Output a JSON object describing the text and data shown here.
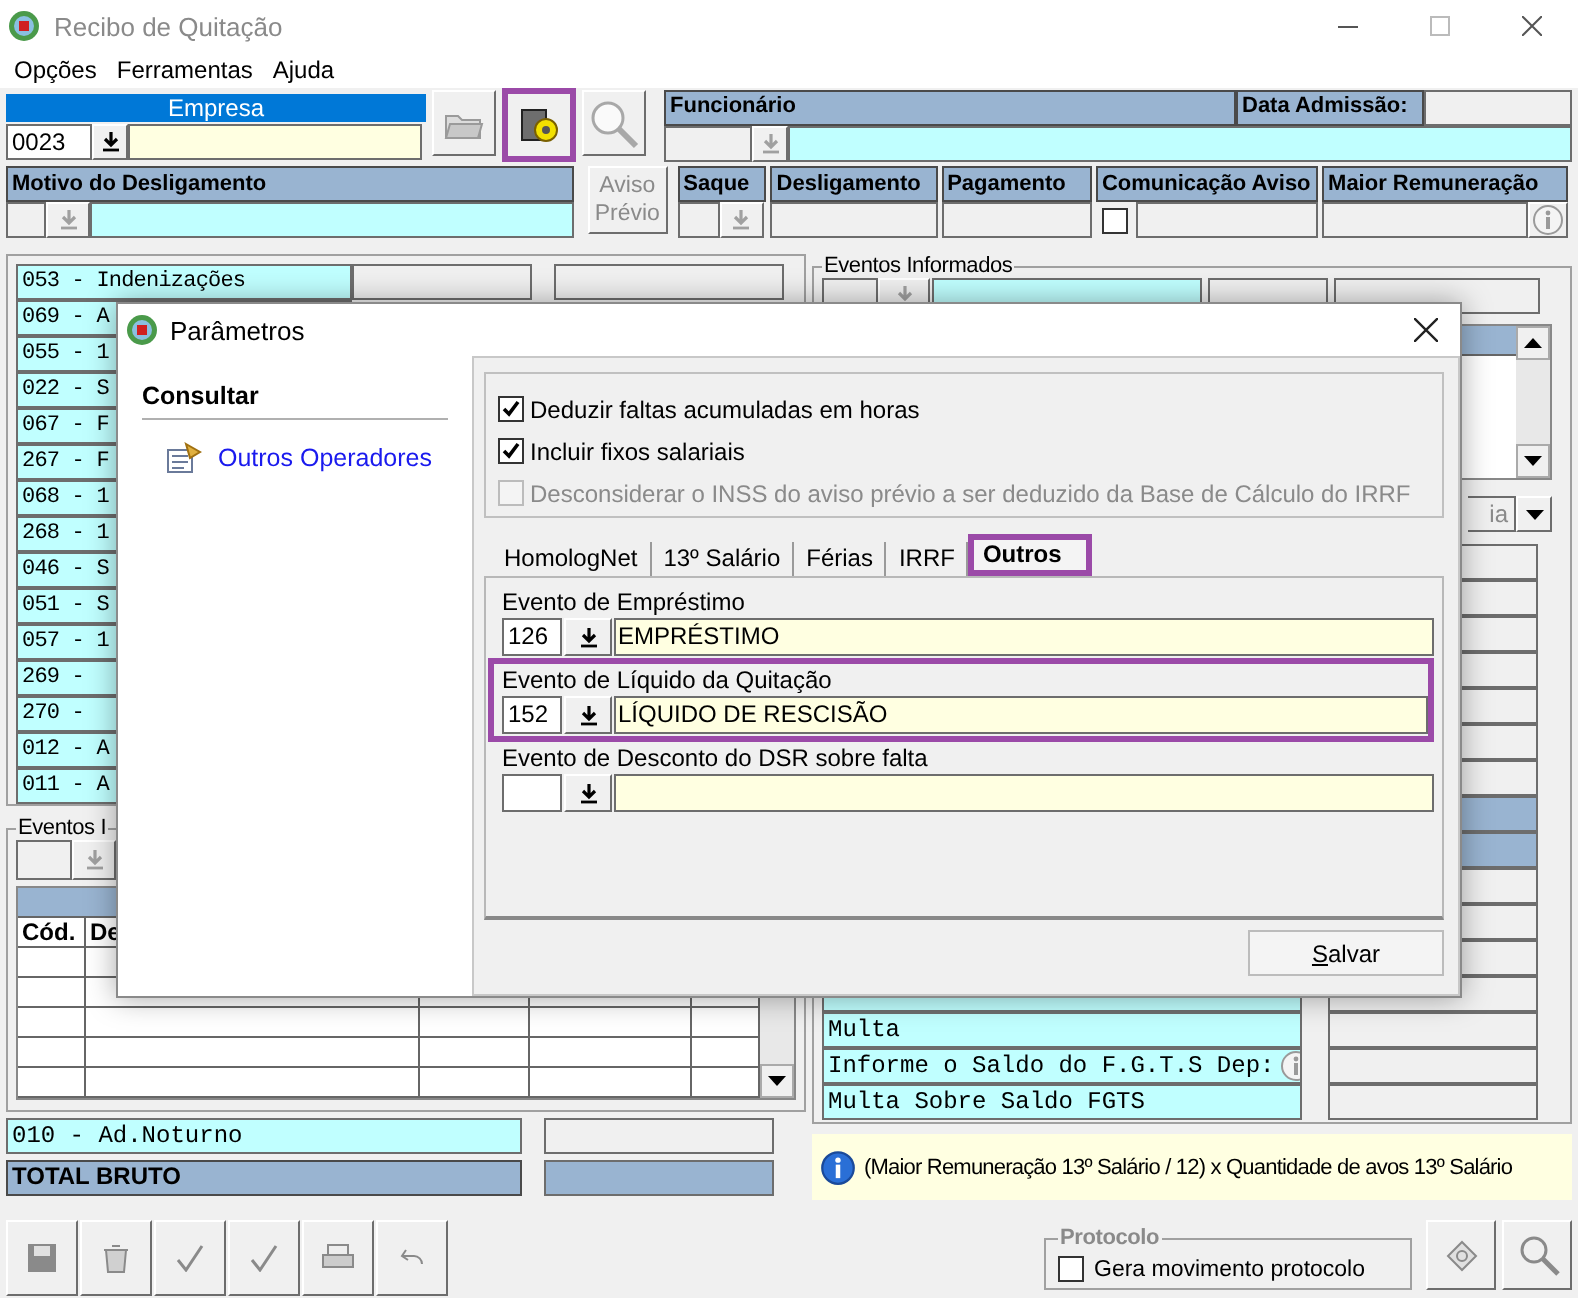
{
  "window": {
    "title": "Recibo de Quitação"
  },
  "menu": [
    "Opções",
    "Ferramentas",
    "Ajuda"
  ],
  "empresa": {
    "label": "Empresa",
    "code": "0023"
  },
  "top_buttons": [
    {
      "kind": "folder",
      "highlighted": false
    },
    {
      "kind": "gear",
      "highlighted": true
    },
    {
      "kind": "magnifier",
      "highlighted": false
    }
  ],
  "funcionario": {
    "label": "Funcionário",
    "admission_label": "Data Admissão:"
  },
  "desligamento": {
    "label": "Motivo do Desligamento",
    "aviso_button": "Aviso Prévio",
    "columns": [
      {
        "label": "Saque",
        "kind": "lookup"
      },
      {
        "label": "Desligamento",
        "kind": "field"
      },
      {
        "label": "Pagamento",
        "kind": "field"
      },
      {
        "label": "Comunicação Aviso",
        "kind": "check",
        "checked": false
      },
      {
        "label": "Maior Remuneração",
        "kind": "info"
      }
    ]
  },
  "event_list": [
    "053 - Indenizações",
    "069 - A",
    "055 - 1",
    "022 - S",
    "067 - F",
    "267 - F",
    "068 - 1",
    "268 - 1",
    "046 - S",
    "051 - S",
    "057 - 1",
    "269 -",
    "270 -",
    "012 - A",
    "011 - A"
  ],
  "eventos": {
    "title": "Eventos I",
    "columns": [
      "Cód.",
      "De"
    ],
    "summary": "010 - Ad.Noturno",
    "total": "TOTAL BRUTO"
  },
  "eventos_informados": {
    "title": "Eventos Informados",
    "combo": "ia",
    "rows": [
      {
        "text": "Multa",
        "info": false
      },
      {
        "text": "Informe o Saldo do F.G.T.S Dep:",
        "info": true
      },
      {
        "text": "Multa Sobre Saldo FGTS",
        "info": false
      }
    ]
  },
  "note": "(Maior Remuneração 13º Salário / 12) x Quantidade de avos 13º Salário",
  "protocolo": {
    "title": "Protocolo",
    "option": "Gera movimento protocolo",
    "checked": false
  },
  "dialog": {
    "title": "Parâmetros",
    "sidebar": {
      "heading": "Consultar",
      "items": [
        "Outros Operadores"
      ]
    },
    "options": [
      {
        "label": "Deduzir faltas acumuladas em horas",
        "checked": true,
        "disabled": false
      },
      {
        "label": "Incluir fixos salariais",
        "checked": true,
        "disabled": false
      },
      {
        "label": "Desconsiderar o INSS do aviso prévio a ser deduzido da Base de Cálculo do IRRF",
        "checked": false,
        "disabled": true
      }
    ],
    "tabs": [
      {
        "label": "HomologNet",
        "selected": false
      },
      {
        "label": "13º Salário",
        "selected": false
      },
      {
        "label": "Férias",
        "selected": false
      },
      {
        "label": "IRRF",
        "selected": false
      },
      {
        "label": "Outros",
        "selected": true
      }
    ],
    "fields": [
      {
        "label": "Evento de Empréstimo",
        "code": "126",
        "description": "EMPRÉSTIMO",
        "highlighted": false
      },
      {
        "label": "Evento de Líquido da Quitação",
        "code": "152",
        "description": "LÍQUIDO DE RESCISÃO",
        "highlighted": true
      },
      {
        "label": "Evento de Desconto do DSR sobre falta",
        "highlighted": false
      }
    ],
    "save_button": "Salvar"
  }
}
